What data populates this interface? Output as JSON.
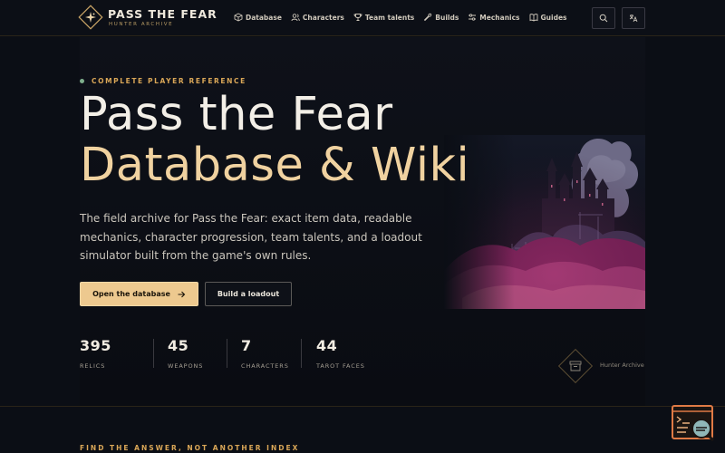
{
  "brand": {
    "title": "PASS THE FEAR",
    "subtitle": "HUNTER ARCHIVE"
  },
  "nav": [
    {
      "label": "Database",
      "icon": "cube-icon"
    },
    {
      "label": "Characters",
      "icon": "users-icon"
    },
    {
      "label": "Team talents",
      "icon": "trophy-icon"
    },
    {
      "label": "Builds",
      "icon": "wrench-icon"
    },
    {
      "label": "Mechanics",
      "icon": "sliders-icon"
    },
    {
      "label": "Guides",
      "icon": "book-icon"
    }
  ],
  "header_actions": {
    "search_icon": "search-icon",
    "language_icon": "translate-icon"
  },
  "hero": {
    "eyebrow": "COMPLETE PLAYER REFERENCE",
    "headline_line1": "Pass the Fear",
    "headline_line2": "Database & Wiki",
    "lead": "The field archive for Pass the Fear: exact item data, readable mechanics, character progression, team talents, and a loadout simulator built from the game's own rules.",
    "primary_cta": "Open the database",
    "secondary_cta": "Build a loadout"
  },
  "stats": [
    {
      "value": "395",
      "label": "RELICS"
    },
    {
      "value": "45",
      "label": "WEAPONS"
    },
    {
      "value": "7",
      "label": "CHARACTERS"
    },
    {
      "value": "44",
      "label": "TAROT FACES"
    }
  ],
  "archive_label": "Hunter Archive",
  "next_section_eyebrow": "FIND THE ANSWER, NOT ANOTHER INDEX",
  "colors": {
    "background": "#0b0e15",
    "accent_gold": "#d9a657",
    "headline_gold": "#f0d2a0",
    "primary_button": "#edc98f",
    "status_dot": "#7fae8c",
    "art_magenta": "#8a2a63"
  }
}
